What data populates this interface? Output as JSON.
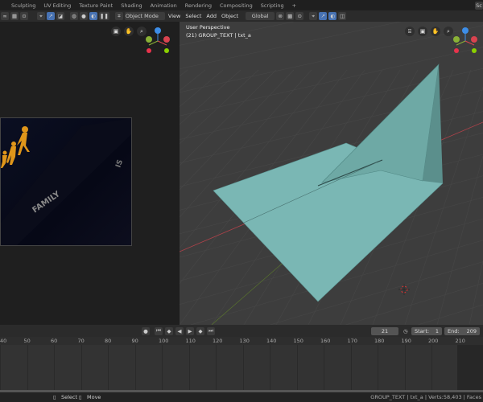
{
  "workspace_tabs": [
    "Sculpting",
    "UV Editing",
    "Texture Paint",
    "Shading",
    "Animation",
    "Rendering",
    "Compositing",
    "Scripting",
    "+"
  ],
  "header": {
    "mode": "Object Mode",
    "menus": [
      "View",
      "Select",
      "Add",
      "Object"
    ],
    "orientation": "Global",
    "scene_label": "Sc"
  },
  "viewport": {
    "perspective": "User Perspective",
    "object_info": "(21) GROUP_TEXT | txt_a",
    "gizmo": {
      "x": "X",
      "y": "Y",
      "z": "Z"
    }
  },
  "image_preview": {
    "text": "FAMILY",
    "text2": "IS"
  },
  "timeline": {
    "current_frame": "21",
    "start_label": "Start:",
    "start": "1",
    "end_label": "End:",
    "end": "209",
    "ticks": [
      "40",
      "50",
      "60",
      "70",
      "80",
      "90",
      "100",
      "110",
      "120",
      "130",
      "140",
      "150",
      "160",
      "170",
      "180",
      "190",
      "200",
      "210"
    ]
  },
  "status": {
    "select": "Select",
    "move": "Move",
    "info": "GROUP_TEXT | txt_a | Verts:58,403 | Faces"
  },
  "colors": {
    "accent": "#4772b3",
    "plane": "#79b8b6",
    "x_axis": "#d9434f",
    "y_axis": "#8ab236",
    "z_axis": "#3d8ee8"
  }
}
